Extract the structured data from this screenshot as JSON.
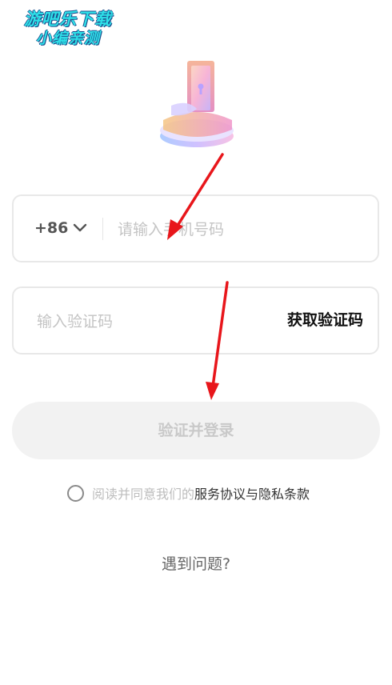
{
  "watermark": {
    "line1": "游吧乐下载",
    "line2": "小编亲测"
  },
  "phone": {
    "country_code": "+86",
    "placeholder": "请输入手机号码",
    "dropdown_icon": "chevron-down-icon"
  },
  "verification": {
    "placeholder": "输入验证码",
    "get_code_label": "获取验证码"
  },
  "login_button": {
    "label": "验证并登录"
  },
  "agreement": {
    "prefix": "阅读并同意我们的",
    "link": "服务协议与隐私条款"
  },
  "help": {
    "label": "遇到问题?"
  },
  "colors": {
    "annotation_arrow": "#e8161b",
    "button_disabled_bg": "#f2f2f2",
    "button_disabled_text": "#c9c9c9",
    "watermark": "#2ee0e8"
  }
}
